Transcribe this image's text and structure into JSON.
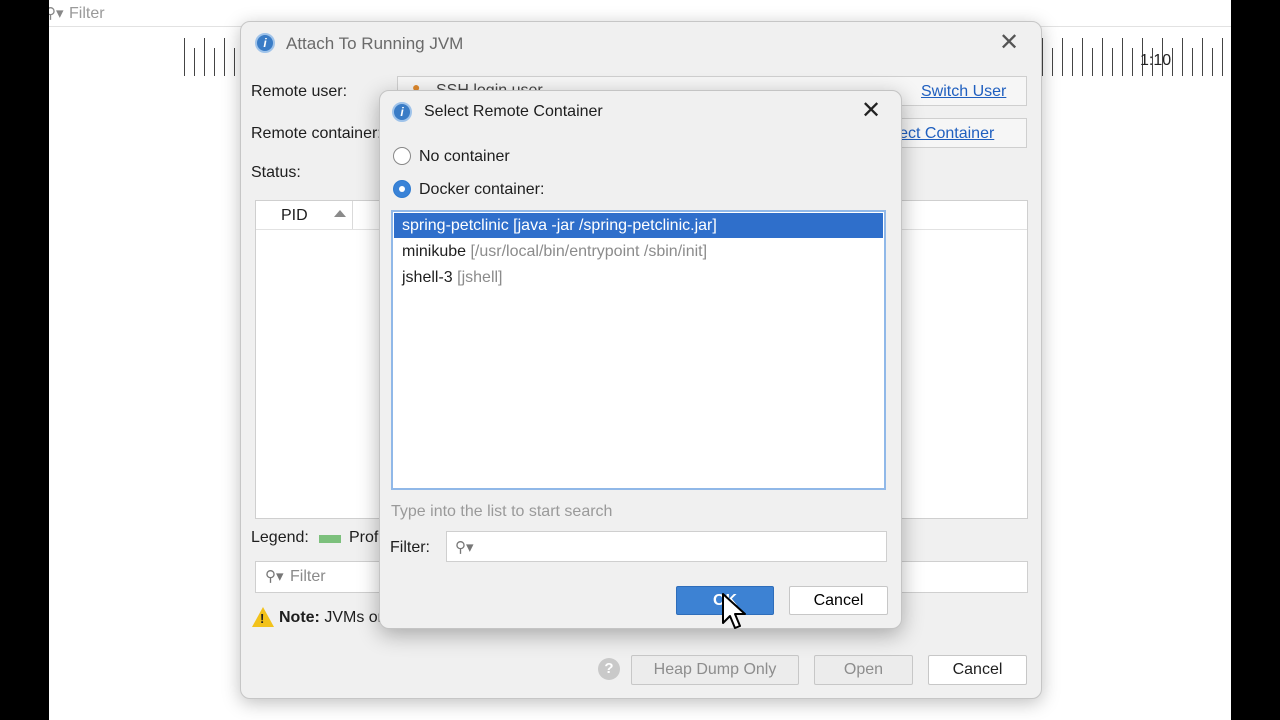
{
  "background": {
    "filter_placeholder": "Filter",
    "time_label": "1:10"
  },
  "main_dialog": {
    "title": "Attach To Running JVM",
    "remote_user_label": "Remote user:",
    "remote_user_value": "SSH login user",
    "switch_user_link": "Switch User",
    "remote_container_label": "Remote container:",
    "select_container_link": "Select Container",
    "status_label": "Status:",
    "table_columns": [
      "PID"
    ],
    "legend_label": "Legend:",
    "legend_item": "Prof",
    "filter_placeholder": "Filter",
    "note_bold": "Note:",
    "note_text": " JVMs or",
    "buttons": {
      "heap_dump": "Heap Dump Only",
      "open": "Open",
      "cancel": "Cancel"
    }
  },
  "modal": {
    "title": "Select Remote Container",
    "options": {
      "no_container": "No container",
      "docker_container": "Docker container:"
    },
    "selected_option": "docker_container",
    "containers": [
      {
        "name": "spring-petclinic",
        "command": "[java -jar /spring-petclinic.jar]",
        "selected": true
      },
      {
        "name": "minikube",
        "command": "[/usr/local/bin/entrypoint /sbin/init]",
        "selected": false
      },
      {
        "name": "jshell-3",
        "command": "[jshell]",
        "selected": false
      }
    ],
    "search_hint": "Type into the list to start search",
    "filter_label": "Filter:",
    "filter_value": "",
    "ok_label": "OK",
    "cancel_label": "Cancel"
  },
  "colors": {
    "accent": "#3d82d3",
    "selection": "#2f6fcb",
    "link": "#1f5fbf",
    "dialog_bg": "#f0f0f0",
    "warning": "#f2c21b",
    "legend_green": "#7cc07c"
  },
  "icons": [
    "app-icon",
    "close-icon",
    "search-icon",
    "chevron-down-icon",
    "sort-ascending-icon",
    "warning-icon",
    "help-icon",
    "user-icon",
    "mouse-cursor-icon"
  ]
}
